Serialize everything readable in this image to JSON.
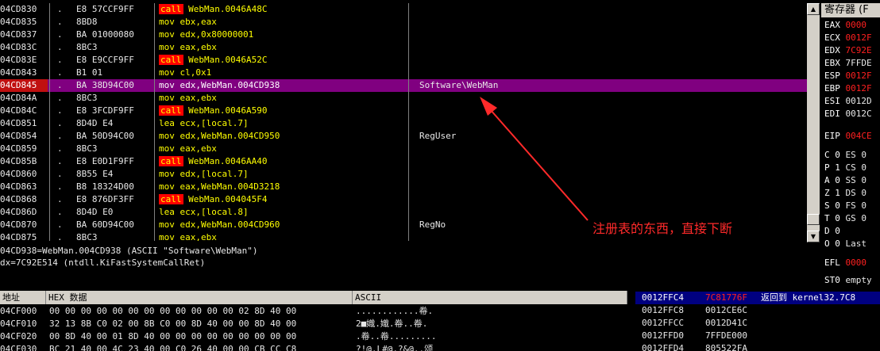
{
  "disassembly": [
    {
      "addr": "04CD830",
      "mark": ".",
      "hex": "E8 57CCF9FF",
      "mn": "call",
      "ops": "WebMan.0046A48C",
      "comment": ""
    },
    {
      "addr": "04CD835",
      "mark": ".",
      "hex": "8BD8",
      "mn": "mov",
      "ops": "ebx,eax",
      "comment": ""
    },
    {
      "addr": "04CD837",
      "mark": ".",
      "hex": "BA 01000080",
      "mn": "mov",
      "ops": "edx,0x80000001",
      "comment": ""
    },
    {
      "addr": "04CD83C",
      "mark": ".",
      "hex": "8BC3",
      "mn": "mov",
      "ops": "eax,ebx",
      "comment": ""
    },
    {
      "addr": "04CD83E",
      "mark": ".",
      "hex": "E8 E9CCF9FF",
      "mn": "call",
      "ops": "WebMan.0046A52C",
      "comment": ""
    },
    {
      "addr": "04CD843",
      "mark": ".",
      "hex": "B1 01",
      "mn": "mov",
      "ops": "cl,0x1",
      "comment": ""
    },
    {
      "addr": "04CD845",
      "mark": ".",
      "hex": "BA 38D94C00",
      "mn": "mov",
      "ops": "edx,WebMan.004CD938",
      "comment": "Software\\WebMan"
    },
    {
      "addr": "04CD84A",
      "mark": ".",
      "hex": "8BC3",
      "mn": "mov",
      "ops": "eax,ebx",
      "comment": ""
    },
    {
      "addr": "04CD84C",
      "mark": ".",
      "hex": "E8 3FCDF9FF",
      "mn": "call",
      "ops": "WebMan.0046A590",
      "comment": ""
    },
    {
      "addr": "04CD851",
      "mark": ".",
      "hex": "8D4D E4",
      "mn": "lea",
      "ops": "ecx,[local.7]",
      "comment": ""
    },
    {
      "addr": "04CD854",
      "mark": ".",
      "hex": "BA 50D94C00",
      "mn": "mov",
      "ops": "edx,WebMan.004CD950",
      "comment": "RegUser"
    },
    {
      "addr": "04CD859",
      "mark": ".",
      "hex": "8BC3",
      "mn": "mov",
      "ops": "eax,ebx",
      "comment": ""
    },
    {
      "addr": "04CD85B",
      "mark": ".",
      "hex": "E8 E0D1F9FF",
      "mn": "call",
      "ops": "WebMan.0046AA40",
      "comment": ""
    },
    {
      "addr": "04CD860",
      "mark": ".",
      "hex": "8B55 E4",
      "mn": "mov",
      "ops": "edx,[local.7]",
      "comment": ""
    },
    {
      "addr": "04CD863",
      "mark": ".",
      "hex": "B8 18324D00",
      "mn": "mov",
      "ops": "eax,WebMan.004D3218",
      "comment": ""
    },
    {
      "addr": "04CD868",
      "mark": ".",
      "hex": "E8 876DF3FF",
      "mn": "call",
      "ops": "WebMan.004045F4",
      "comment": ""
    },
    {
      "addr": "04CD86D",
      "mark": ".",
      "hex": "8D4D E0",
      "mn": "lea",
      "ops": "ecx,[local.8]",
      "comment": ""
    },
    {
      "addr": "04CD870",
      "mark": ".",
      "hex": "BA 60D94C00",
      "mn": "mov",
      "ops": "edx,WebMan.004CD960",
      "comment": "RegNo"
    },
    {
      "addr": "04CD875",
      "mark": ".",
      "hex": "8BC3",
      "mn": "mov",
      "ops": "eax,ebx",
      "comment": ""
    }
  ],
  "info": {
    "line1": "04CD938=WebMan.004CD938 (ASCII \"Software\\WebMan\")",
    "line2": "dx=7C92E514 (ntdll.KiFastSystemCallRet)"
  },
  "registers": {
    "title": "寄存器 (F",
    "rows": [
      {
        "n": "EAX",
        "v": "0000"
      },
      {
        "n": "ECX",
        "v": "0012F"
      },
      {
        "n": "EDX",
        "v": "7C92E"
      },
      {
        "n": "EBX",
        "w": "7FFDE"
      },
      {
        "n": "ESP",
        "v": "0012F"
      },
      {
        "n": "EBP",
        "v": "0012F"
      },
      {
        "n": "ESI",
        "w": "0012D"
      },
      {
        "n": "EDI",
        "w": "0012C"
      },
      {
        "n": "EIP",
        "v": "004CE"
      },
      {
        "n": "C 0",
        "w": "ES 0"
      },
      {
        "n": "P 1",
        "w": "CS 0"
      },
      {
        "n": "A 0",
        "w": "SS 0"
      },
      {
        "n": "Z 1",
        "w": "DS 0"
      },
      {
        "n": "S 0",
        "w": "FS 0"
      },
      {
        "n": "T 0",
        "w": "GS 0"
      },
      {
        "n": "D 0",
        "w": ""
      },
      {
        "n": "O 0",
        "w": "Last"
      },
      {
        "n": "EFL",
        "v": "0000"
      },
      {
        "n": "ST0",
        "w": "empty"
      }
    ]
  },
  "dump": {
    "headers": {
      "addr": "地址",
      "hex": "HEX 数据",
      "ascii": "ASCII"
    },
    "rows": [
      {
        "addr": "04CF000",
        "hex": "00 00 00 00 00 00 00 00 00 00 00 00 02 8D 40 00",
        "ascii": "............帣."
      },
      {
        "addr": "04CF010",
        "hex": "32 13 8B C0 02 00 8B C0 00 8D 40 00 00 8D 40 00",
        "ascii": "2■嬂.嬂.帣..帣."
      },
      {
        "addr": "04CF020",
        "hex": "00 8D 40 00 01 8D 40 00 00 00 00 00 00 00 00 00",
        "ascii": ".帣..帣........."
      },
      {
        "addr": "04CF030",
        "hex": "BC 21 40 00 4C 23 40 00 C0 26 40 00 00 CB CC C8",
        "ascii": "?!@.L#@.?&@..颂"
      }
    ]
  },
  "stack": {
    "rows": [
      {
        "addr": "0012FFC4",
        "val": "7C81776F",
        "cmt": "返回到 kernel32.7C8"
      },
      {
        "addr": "0012FFC8",
        "val": "0012CE6C",
        "cmt": ""
      },
      {
        "addr": "0012FFCC",
        "val": "0012D41C",
        "cmt": ""
      },
      {
        "addr": "0012FFD0",
        "val": "7FFDE000",
        "cmt": ""
      },
      {
        "addr": "0012FFD4",
        "val": "805522FA",
        "cmt": ""
      }
    ]
  },
  "annotation": {
    "text": "注册表的东西，直接下断",
    "color": "#ff2a2a"
  },
  "colors": {
    "selection": "#800080",
    "call_bg": "#ff0000",
    "mnemonic": "#ffff00",
    "register_changed": "#ff2020"
  }
}
